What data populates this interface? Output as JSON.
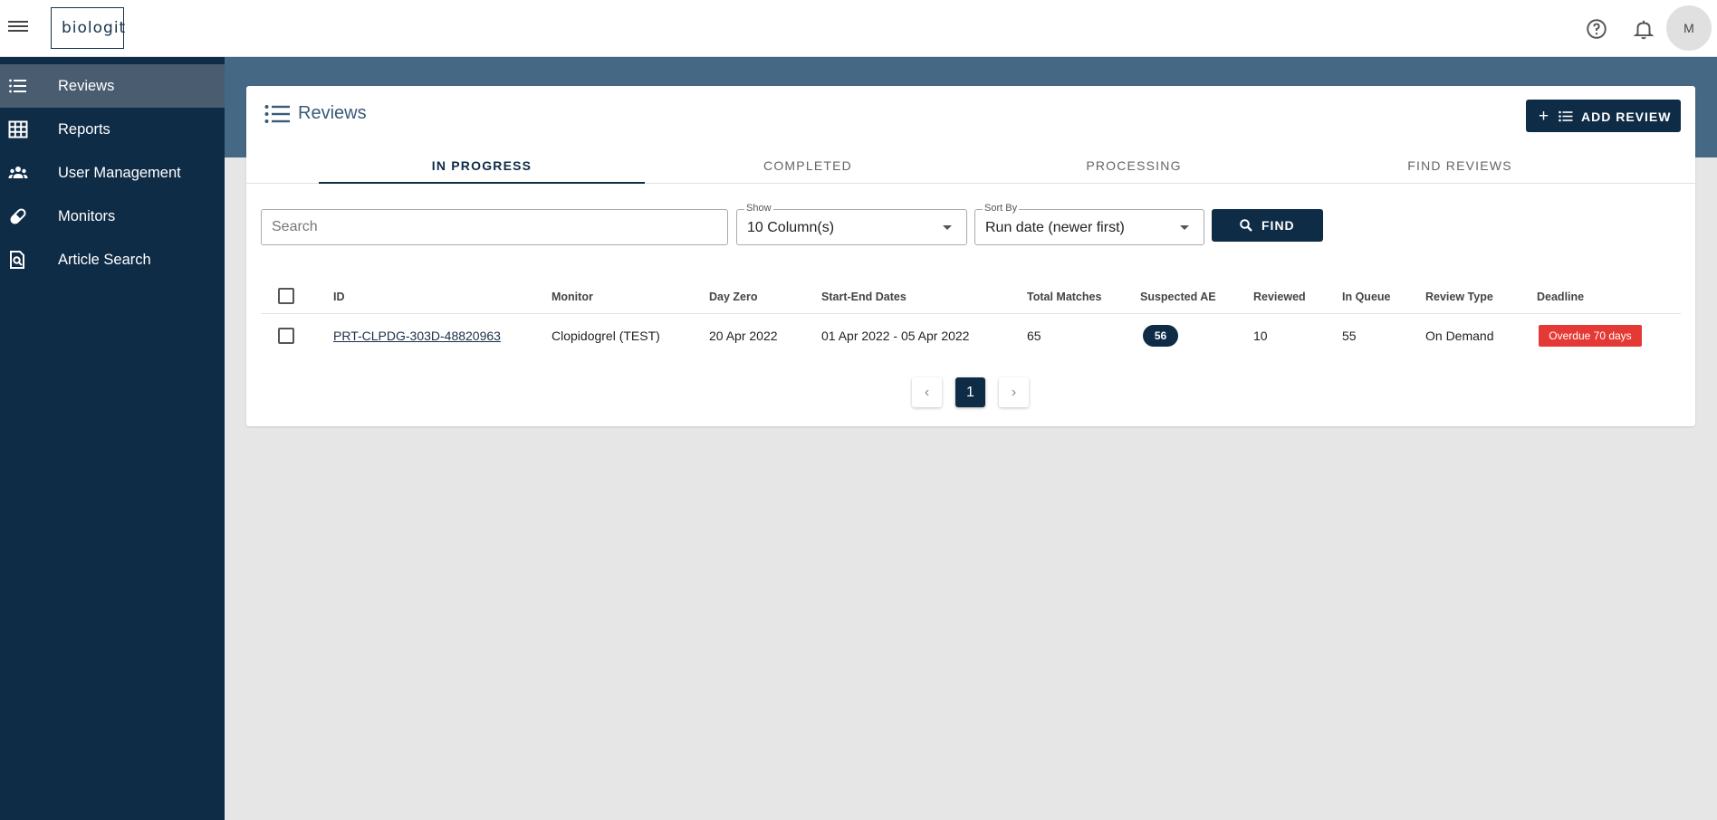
{
  "app": {
    "logo_text": "biologit",
    "user_initial": "M"
  },
  "sidebar": {
    "items": [
      {
        "label": "Reviews",
        "icon": "list-icon",
        "active": true
      },
      {
        "label": "Reports",
        "icon": "table-icon"
      },
      {
        "label": "User Management",
        "icon": "people-icon"
      },
      {
        "label": "Monitors",
        "icon": "pill-icon"
      },
      {
        "label": "Article Search",
        "icon": "document-search-icon"
      }
    ]
  },
  "page": {
    "title": "Reviews",
    "add_button": "ADD REVIEW",
    "tabs": [
      {
        "label": "IN PROGRESS",
        "active": true
      },
      {
        "label": "COMPLETED"
      },
      {
        "label": "PROCESSING"
      },
      {
        "label": "FIND REVIEWS"
      }
    ]
  },
  "filters": {
    "search_placeholder": "Search",
    "show_label": "Show",
    "show_value": "10 Column(s)",
    "sort_label": "Sort By",
    "sort_value": "Run date (newer first)",
    "find_button": "FIND"
  },
  "table": {
    "headers": [
      "ID",
      "Monitor",
      "Day Zero",
      "Start-End Dates",
      "Total Matches",
      "Suspected AE",
      "Reviewed",
      "In Queue",
      "Review Type",
      "Deadline"
    ],
    "rows": [
      {
        "id": "PRT-CLPDG-303D-48820963",
        "monitor": "Clopidogrel (TEST)",
        "day_zero": "20 Apr 2022",
        "dates": "01 Apr 2022 - 05 Apr 2022",
        "total_matches": "65",
        "suspected_ae": "56",
        "reviewed": "10",
        "in_queue": "55",
        "review_type": "On Demand",
        "deadline": "Overdue 70 days"
      }
    ]
  },
  "pagination": {
    "current": "1",
    "prev": "‹",
    "next": "›"
  },
  "colors": {
    "navy": "#0f2c47",
    "banner": "#456884",
    "overdue": "#e53935",
    "sidebar_active": "#4a5c70"
  }
}
